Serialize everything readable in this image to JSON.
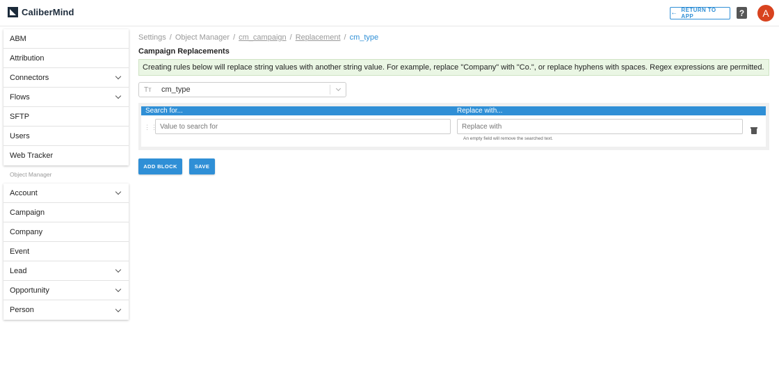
{
  "header": {
    "brand": "CaliberMind",
    "return_label": "RETURN TO APP",
    "help_label": "?",
    "avatar_initial": "A"
  },
  "sidebar": {
    "primary": [
      {
        "label": "ABM",
        "expandable": false
      },
      {
        "label": "Attribution",
        "expandable": false
      },
      {
        "label": "Connectors",
        "expandable": true
      },
      {
        "label": "Flows",
        "expandable": true
      },
      {
        "label": "SFTP",
        "expandable": false
      },
      {
        "label": "Users",
        "expandable": false
      },
      {
        "label": "Web Tracker",
        "expandable": false
      }
    ],
    "section_label": "Object Manager",
    "objects": [
      {
        "label": "Account",
        "expandable": true
      },
      {
        "label": "Campaign",
        "expandable": false
      },
      {
        "label": "Company",
        "expandable": false
      },
      {
        "label": "Event",
        "expandable": false
      },
      {
        "label": "Lead",
        "expandable": true
      },
      {
        "label": "Opportunity",
        "expandable": true
      },
      {
        "label": "Person",
        "expandable": true
      }
    ]
  },
  "breadcrumb": {
    "items": [
      "Settings",
      "Object Manager",
      "cm_campaign",
      "Replacement",
      "cm_type"
    ],
    "separator": "/"
  },
  "page": {
    "title": "Campaign Replacements",
    "info": "Creating rules below will replace string values with another string value. For example, replace \"Company\" with \"Co.\", or replace hyphens with spaces. Regex expressions are permitted."
  },
  "field_select": {
    "icon": "text-type-icon",
    "value": "cm_type"
  },
  "block": {
    "search_header": "Search for...",
    "replace_header": "Replace with...",
    "search_placeholder": "Value to search for",
    "replace_placeholder": "Replace with",
    "hint": "An empty field will remove the searched text."
  },
  "actions": {
    "add_block": "ADD BLOCK",
    "save": "SAVE"
  },
  "colors": {
    "accent": "#2f8fd6",
    "info_bg": "#eaf6e4",
    "avatar": "#d8431f"
  }
}
